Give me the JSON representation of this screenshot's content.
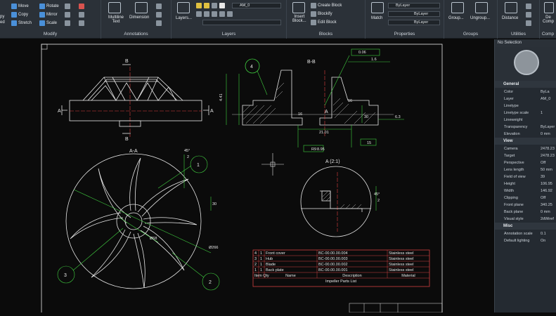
{
  "ribbon": {
    "modify": {
      "title": "Modify",
      "items": [
        "Move",
        "Copy",
        "Stretch",
        "Rotate",
        "Mirror",
        "Scale"
      ],
      "left_label": "py",
      "left_label2": "ed"
    },
    "annotations": {
      "title": "Annotations",
      "multiline": "Multiline",
      "multiline2": "Text",
      "dimension": "Dimension"
    },
    "layers": {
      "title": "Layers",
      "layers_button": "Layers...",
      "current_layer": "AM_0"
    },
    "blocks": {
      "title": "Blocks",
      "insert": "Insert",
      "insert2": "Block...",
      "create": "Create Block",
      "blockify": "Blockify",
      "edit": "Edit Block"
    },
    "properties": {
      "title": "Properties",
      "match": "Match",
      "color": "ByLayer",
      "linetype": "ByLayer",
      "lineweight": "ByLayer"
    },
    "groups": {
      "title": "Groups",
      "group": "Group...",
      "ungroup": "Ungroup..."
    },
    "utilities": {
      "title": "Utilities",
      "distance": "Distance"
    },
    "compare": {
      "title": "Comp",
      "de": "De",
      "comp": "Comp"
    }
  },
  "drawing": {
    "section_bb": "B-B",
    "section_aa": "A-A",
    "detail_a": "A (2:1)",
    "label_a": "A",
    "label_b": "B",
    "balloons": [
      "4",
      "1",
      "3",
      "2"
    ],
    "dims": {
      "d1": "4.41",
      "d2": "16",
      "d3": "21.01",
      "d4": "R9",
      "d5": "30",
      "d6": "6.3",
      "d7": "45°",
      "d8": "2",
      "d9": "Ø68",
      "d10": "Ø266",
      "d11": "30",
      "d12": "45°",
      "d13": "2",
      "d14": "0.06",
      "d15": "1.6",
      "d16": "16",
      "d17": "8.95",
      "d18": "15"
    }
  },
  "parts_list": {
    "title": "Impeller Parts List",
    "headers": [
      "Item",
      "Qty",
      "Name",
      "Description",
      "Material"
    ],
    "rows": [
      [
        "4",
        "1",
        "Front cover",
        "BC-00.00.00.004",
        "Stainless steel"
      ],
      [
        "3",
        "1",
        "Hub",
        "BC-00.00.00.003",
        "Stainless steel"
      ],
      [
        "2",
        "1",
        "Blade",
        "BC-00.00.00.002",
        "Stainless steel"
      ],
      [
        "1",
        "1",
        "Back plate",
        "BC-00.00.00.001",
        "Stainless steel"
      ]
    ]
  },
  "properties_panel": {
    "selection": "No Selection",
    "general": {
      "header": "General",
      "rows": [
        [
          "Color",
          "ByLa"
        ],
        [
          "Layer",
          "AM_0"
        ],
        [
          "Linetype",
          ""
        ],
        [
          "Linetype scale",
          "1"
        ],
        [
          "Lineweight",
          ""
        ],
        [
          "Transparency",
          "ByLayer"
        ],
        [
          "Elevation",
          "0 mm"
        ]
      ]
    },
    "view": {
      "header": "View",
      "rows": [
        [
          "Camera",
          "2478.23"
        ],
        [
          "Target",
          "2478.23"
        ],
        [
          "Perspective",
          "Off"
        ],
        [
          "Lens length",
          "50 mm"
        ],
        [
          "Field of view",
          "39"
        ],
        [
          "Height",
          "106.95"
        ],
        [
          "Width",
          "146.92"
        ],
        [
          "Clipping",
          "Off"
        ],
        [
          "Front plane",
          "340.25"
        ],
        [
          "Back plane",
          "0 mm"
        ],
        [
          "Visual style",
          "2dWiref"
        ]
      ]
    },
    "misc": {
      "header": "Misc",
      "rows": [
        [
          "Annotation scale",
          "0.1"
        ],
        [
          "Default lighting",
          "On"
        ]
      ]
    }
  }
}
